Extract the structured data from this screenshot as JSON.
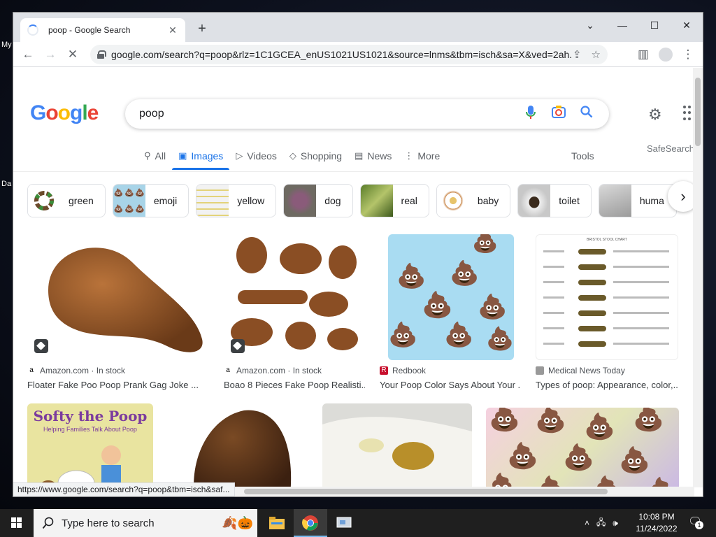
{
  "desktop": {
    "icon_labels": [
      "My",
      "Da"
    ]
  },
  "browser": {
    "tab_title": "poop - Google Search",
    "url": "google.com/search?q=poop&rlz=1C1GCEA_enUS1021US1021&source=lnms&tbm=isch&sa=X&ved=2ah...",
    "status_url": "https://www.google.com/search?q=poop&tbm=isch&saf..."
  },
  "google": {
    "logo_letters": [
      "G",
      "o",
      "o",
      "g",
      "l",
      "e"
    ],
    "logo_colors": [
      "#4285F4",
      "#EA4335",
      "#FBBC05",
      "#4285F4",
      "#34A853",
      "#EA4335"
    ],
    "query": "poop",
    "nav_tabs": [
      {
        "label": "All",
        "icon": "search-icon"
      },
      {
        "label": "Images",
        "icon": "image-icon"
      },
      {
        "label": "Videos",
        "icon": "play-icon"
      },
      {
        "label": "Shopping",
        "icon": "tag-icon"
      },
      {
        "label": "News",
        "icon": "newspaper-icon"
      },
      {
        "label": "More",
        "icon": "more-vert-icon"
      }
    ],
    "tools_label": "Tools",
    "safesearch_label": "SafeSearch",
    "chips": [
      "green",
      "emoji",
      "yellow",
      "dog",
      "real",
      "baby",
      "toilet",
      "huma"
    ]
  },
  "results": [
    {
      "source": "Amazon.com · In stock",
      "title": "Floater Fake Poo Poop Prank Gag Joke ..."
    },
    {
      "source": "Amazon.com · In stock",
      "title": "Boao 8 Pieces Fake Poop Realisti..."
    },
    {
      "source": "Redbook",
      "title": "Your Poop Color Says About Your ..."
    },
    {
      "source": "Medical News Today",
      "title": "Types of poop: Appearance, color,..."
    }
  ],
  "book_cover": {
    "title": "Softy the Poop",
    "subtitle": "Helping Families Talk About Poop"
  },
  "stool_chart_title": "BRISTOL STOOL CHART",
  "taskbar": {
    "search_placeholder": "Type here to search",
    "time": "10:08 PM",
    "date": "11/24/2022",
    "notification_count": "1"
  },
  "colors": {
    "google_blue": "#1a73e8",
    "taskbar_bg": "#1f1f1f"
  }
}
